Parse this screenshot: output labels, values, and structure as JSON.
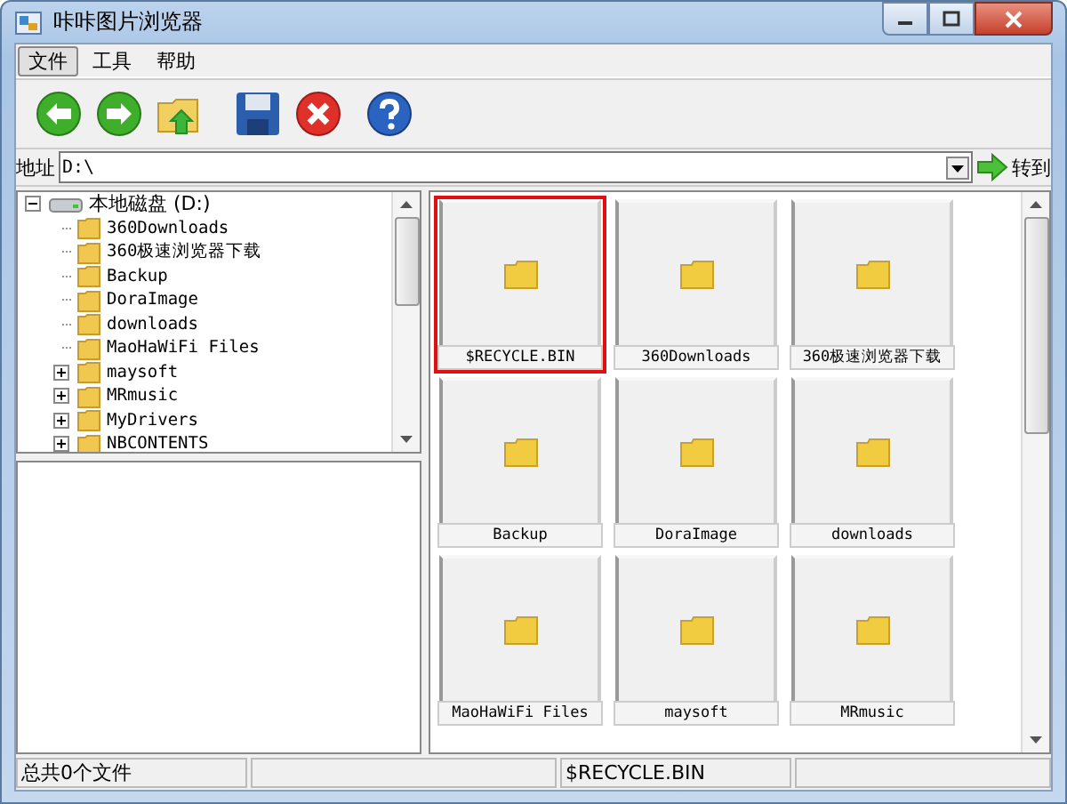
{
  "window": {
    "title": "咔咔图片浏览器"
  },
  "menu": [
    {
      "label": "文件",
      "selected": true
    },
    {
      "label": "工具",
      "selected": false
    },
    {
      "label": "帮助",
      "selected": false
    }
  ],
  "toolbar": [
    {
      "kind": "back"
    },
    {
      "kind": "forward"
    },
    {
      "kind": "up"
    },
    {
      "kind": "save"
    },
    {
      "kind": "delete"
    },
    {
      "kind": "help"
    }
  ],
  "address": {
    "label": "地址",
    "value": "D:\\",
    "go": "转到"
  },
  "tree": {
    "label": "本地磁盘 (D:)",
    "expanded": true,
    "children": [
      {
        "label": "360Downloads",
        "expandable": false
      },
      {
        "label": "360极速浏览器下载",
        "expandable": false
      },
      {
        "label": "Backup",
        "expandable": false
      },
      {
        "label": "DoraImage",
        "expandable": false
      },
      {
        "label": "downloads",
        "expandable": false
      },
      {
        "label": "MaoHaWiFi Files",
        "expandable": false
      },
      {
        "label": "maysoft",
        "expandable": true
      },
      {
        "label": "MRmusic",
        "expandable": true
      },
      {
        "label": "MyDrivers",
        "expandable": true
      },
      {
        "label": "NBCONTENTS",
        "expandable": true
      }
    ]
  },
  "thumbnails": [
    {
      "name": "$RECYCLE.BIN",
      "selected": true
    },
    {
      "name": "360Downloads",
      "selected": false
    },
    {
      "name": "360极速浏览器下载",
      "selected": false
    },
    {
      "name": "Backup",
      "selected": false
    },
    {
      "name": "DoraImage",
      "selected": false
    },
    {
      "name": "downloads",
      "selected": false
    },
    {
      "name": "MaoHaWiFi Files",
      "selected": false
    },
    {
      "name": "maysoft",
      "selected": false
    },
    {
      "name": "MRmusic",
      "selected": false
    }
  ],
  "status_bar": [
    "总共0个文件",
    "$RECYCLE.BIN"
  ]
}
